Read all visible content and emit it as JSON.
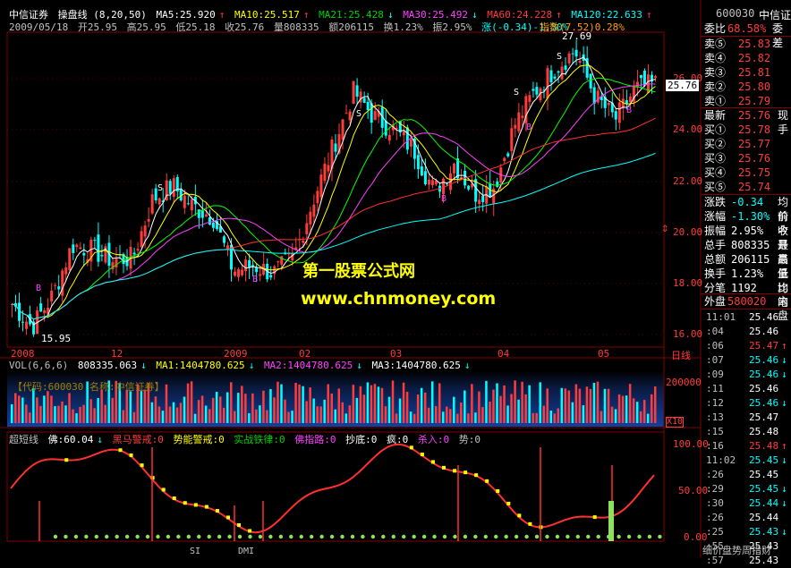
{
  "main_header": {
    "stock_name": "中信证券",
    "indicator": "操盘线 (8,20,50)",
    "ma5": "MA5:25.920",
    "ma10": "MA10:25.517",
    "ma21": "MA21:25.428",
    "ma30": "MA30:25.492",
    "ma60": "MA60:24.228",
    "ma120": "MA120:22.633"
  },
  "bar_info": {
    "date": "2009/05/18",
    "open": "开25.95",
    "high": "高25.95",
    "low": "低25.18",
    "close": "收25.76",
    "volume": "量808335",
    "amount": "额206115",
    "turnover": "换1.23%",
    "amplitude": "振2.95%",
    "change": "涨(-0.34)-1.30%",
    "index_label": "指数(7.52)0.28%"
  },
  "price_chart": {
    "price_axis": [
      "26.00",
      "24.00",
      "22.00",
      "20.00",
      "18.00",
      "16.00"
    ],
    "current_price_tag": "25.76",
    "high_annotation": "27.69",
    "low_annotation": "15.95",
    "date_axis": [
      "2008",
      "12",
      "2009",
      "02",
      "03",
      "04",
      "05"
    ],
    "date_axis_end": "日线",
    "buy_marker": "B",
    "sell_marker": "S"
  },
  "watermark": {
    "line1": "第一股票公式网",
    "line2": "www.chnmoney.com"
  },
  "volume_header": {
    "vol": "VOL(6,6,6)",
    "vol_value": "808335.063",
    "ma1": "MA1:1404780.625",
    "ma2": "MA2:1404780.625",
    "ma3": "MA3:1404780.625",
    "code_box": "【代码:600030 名称:中信证券】",
    "axis_top": "200000",
    "axis_unit": "X10"
  },
  "indicator_header": {
    "name": "超短线",
    "fo": "佛:60.04",
    "heima": "黑马警戒:0",
    "shineng": "势能警戒:0",
    "shizhan": "实战铁律:0",
    "fozhilu": "佛指路:0",
    "chaodi": "抄底:0",
    "feng": "疯:0",
    "sharu": "杀入:0",
    "shi": "势:0",
    "axis": [
      "100.00",
      "50.00",
      "0.00"
    ]
  },
  "bottom_tabs": [
    "SI",
    "DMI"
  ],
  "quote_panel": {
    "code": "600030",
    "name": "中信证",
    "weibi_label": "委比",
    "weibi_value": "68.58%",
    "weibi_ext": "委差",
    "asks": [
      {
        "label": "卖⑤",
        "price": "25.83"
      },
      {
        "label": "卖④",
        "price": "25.82"
      },
      {
        "label": "卖③",
        "price": "25.81"
      },
      {
        "label": "卖②",
        "price": "25.80"
      },
      {
        "label": "卖①",
        "price": "25.79"
      }
    ],
    "last_label": "最新",
    "last_price": "25.76",
    "last_ext": "现手",
    "bids": [
      {
        "label": "买①",
        "price": "25.78"
      },
      {
        "label": "买②",
        "price": "25.77"
      },
      {
        "label": "买③",
        "price": "25.76"
      },
      {
        "label": "买④",
        "price": "25.75"
      },
      {
        "label": "买⑤",
        "price": "25.74"
      }
    ],
    "stats": [
      {
        "label": "涨跌",
        "value": "-0.34",
        "ext": "均价"
      },
      {
        "label": "涨幅",
        "value": "-1.30%",
        "ext": "前收"
      },
      {
        "label": "振幅",
        "value": "2.95%",
        "ext": "今开"
      },
      {
        "label": "总手",
        "value": "808335",
        "ext": "最高"
      },
      {
        "label": "总额",
        "value": "206115",
        "ext": "最低"
      },
      {
        "label": "换手",
        "value": "1.23%",
        "ext": "量比"
      },
      {
        "label": "分笔",
        "value": "1192",
        "ext": "均笔"
      }
    ],
    "waipan_label": "外盘",
    "waipan_value": "580020",
    "neipan_label": "内盘",
    "ticks": [
      {
        "time": "11:01",
        "price": "25.46",
        "arrow": ""
      },
      {
        "time": ":04",
        "price": "25.46",
        "arrow": ""
      },
      {
        "time": ":06",
        "price": "25.47",
        "arrow": "↑"
      },
      {
        "time": ":07",
        "price": "25.46",
        "arrow": "↓"
      },
      {
        "time": ":09",
        "price": "25.46",
        "arrow": "↓"
      },
      {
        "time": ":11",
        "price": "25.46",
        "arrow": ""
      },
      {
        "time": ":12",
        "price": "25.46",
        "arrow": "↓"
      },
      {
        "time": ":13",
        "price": "25.47",
        "arrow": ""
      },
      {
        "time": ":15",
        "price": "25.48",
        "arrow": ""
      },
      {
        "time": ":16",
        "price": "25.48",
        "arrow": "↑"
      },
      {
        "time": "11:02",
        "price": "25.45",
        "arrow": "↓"
      },
      {
        "time": ":26",
        "price": "25.45",
        "arrow": ""
      },
      {
        "time": ":29",
        "price": "25.45",
        "arrow": "↓"
      },
      {
        "time": ":30",
        "price": "25.44",
        "arrow": "↓"
      },
      {
        "time": ":26",
        "price": "25.44",
        "arrow": ""
      },
      {
        "time": ":25",
        "price": "25.43",
        "arrow": "↓"
      },
      {
        "time": ":55",
        "price": "25.43",
        "arrow": ""
      },
      {
        "time": ":57",
        "price": "25.43",
        "arrow": ""
      }
    ],
    "footer": "细价盘势周指财"
  },
  "colors": {
    "up": "#ff3c3c",
    "down": "#00ffff",
    "ma5": "#ffffff",
    "ma10": "#ffff00",
    "ma21": "#00ff00",
    "ma30": "#ff40ff",
    "ma60": "#ff3030",
    "ma120": "#00ffff"
  }
}
